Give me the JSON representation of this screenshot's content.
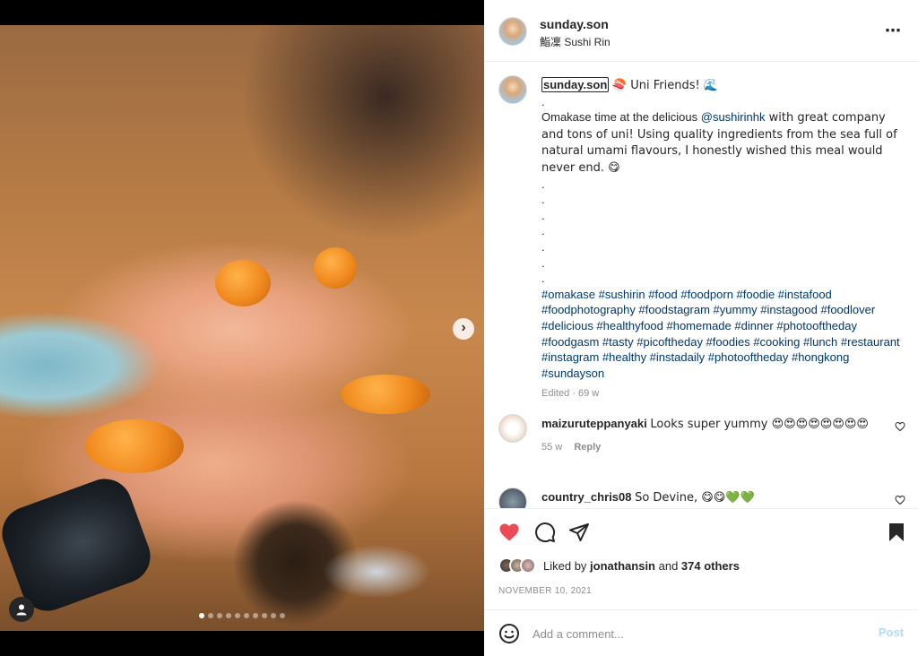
{
  "post": {
    "username": "sunday.son",
    "location": "鮨凜 Sushi Rin",
    "more_icon": "⋯",
    "photo_alt": "Uni sushi served on hands",
    "carousel": {
      "total": 10,
      "active": 0
    }
  },
  "caption": {
    "username": "sunday.son",
    "title_suffix": "🍣 Uni Friends! 🌊",
    "line_dot": ".",
    "body_pre": "Omakase time at the delicious ",
    "mention": "@sushirinhk",
    "body_post": " with great company and tons of uni! Using quality ingredients from the sea full of natural umami flavours, I honestly wished this meal would never end. 😋",
    "dots": [
      ".",
      ".",
      ".",
      ".",
      ".",
      ".",
      "."
    ],
    "hashtags": "#omakase #sushirin #food #foodporn #foodie #instafood #foodphotography #foodstagram #yummy #instagood #foodlover #delicious #healthyfood #homemade #dinner #photooftheday #foodgasm #tasty #picoftheday #foodies #cooking #lunch #restaurant #instagram #healthy #instadaily #photooftheday #hongkong #sundayson",
    "meta": "Edited · 69 w"
  },
  "comments": [
    {
      "username": "maizuruteppanyaki",
      "text": "Looks super yummy 😍😍😍😍😍😍😍😍",
      "time": "55 w",
      "reply": "Reply"
    },
    {
      "username": "country_chris08",
      "text": "So Devine, 😋😋💚💚",
      "time": "",
      "reply": ""
    }
  ],
  "actions": {
    "liked_by_prefix": "Liked by ",
    "liked_by_user": "jonathansin",
    "liked_by_and": " and ",
    "liked_by_count": "374 others",
    "date": "NOVEMBER 10, 2021"
  },
  "add_comment": {
    "placeholder": "Add a comment...",
    "post_label": "Post"
  },
  "colors": {
    "like_red": "#ed4956",
    "link_blue": "#00376b",
    "post_disabled": "#b3dbff"
  }
}
